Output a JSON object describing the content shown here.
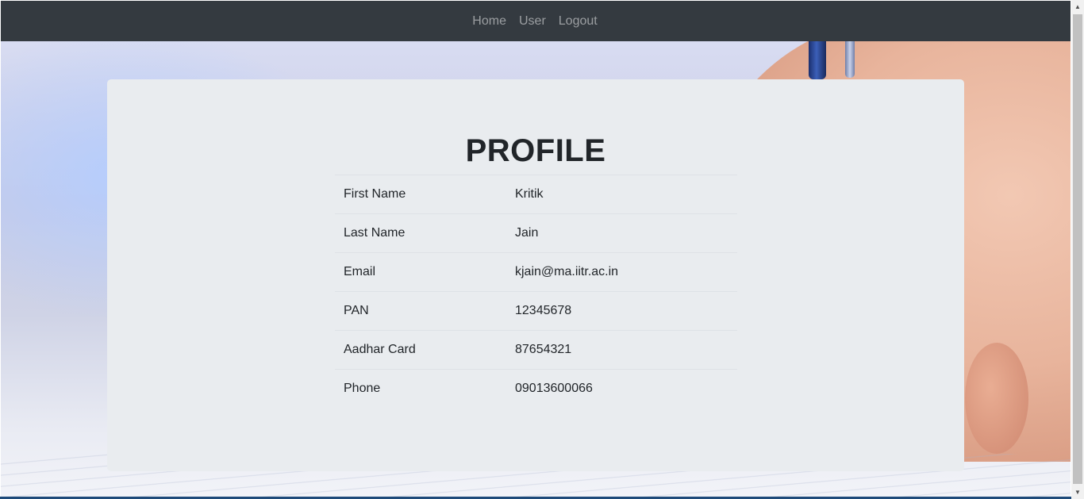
{
  "navbar": {
    "links": [
      {
        "label": "Home"
      },
      {
        "label": "User"
      },
      {
        "label": "Logout"
      }
    ]
  },
  "profile": {
    "title": "PROFILE",
    "rows": [
      {
        "label": "First Name",
        "value": "Kritik"
      },
      {
        "label": "Last Name",
        "value": "Jain"
      },
      {
        "label": "Email",
        "value": "kjain@ma.iitr.ac.in"
      },
      {
        "label": "PAN",
        "value": "12345678"
      },
      {
        "label": "Aadhar Card",
        "value": "87654321"
      },
      {
        "label": "Phone",
        "value": "09013600066"
      }
    ]
  },
  "colors": {
    "navbar_bg": "#343a40",
    "card_bg": "#e9ecef",
    "text": "#212529"
  },
  "icons": {
    "scroll_up": "scroll-up-arrow-icon",
    "scroll_down": "scroll-down-arrow-icon"
  }
}
